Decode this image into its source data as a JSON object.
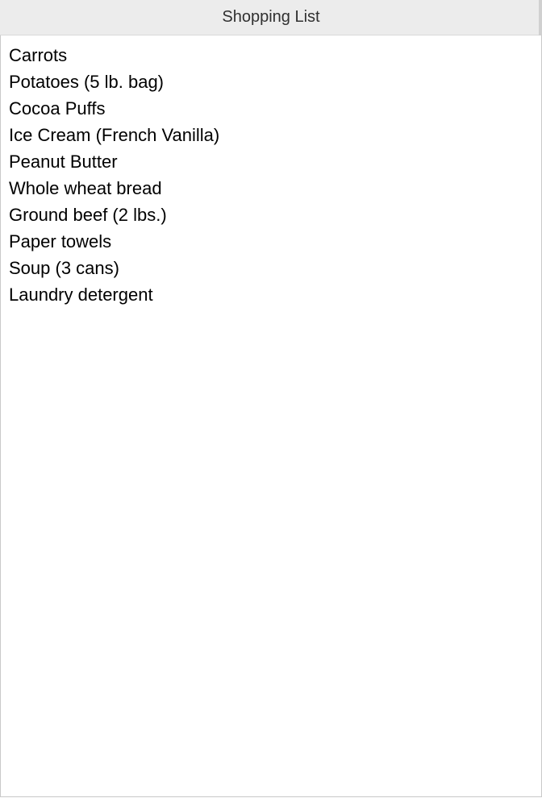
{
  "window": {
    "title": "Shopping List"
  },
  "items": [
    "Carrots",
    "Potatoes (5 lb. bag)",
    "Cocoa Puffs",
    "Ice Cream (French Vanilla)",
    "Peanut Butter",
    "Whole wheat bread",
    "Ground beef (2 lbs.)",
    "Paper towels",
    "Soup (3 cans)",
    "Laundry detergent"
  ]
}
